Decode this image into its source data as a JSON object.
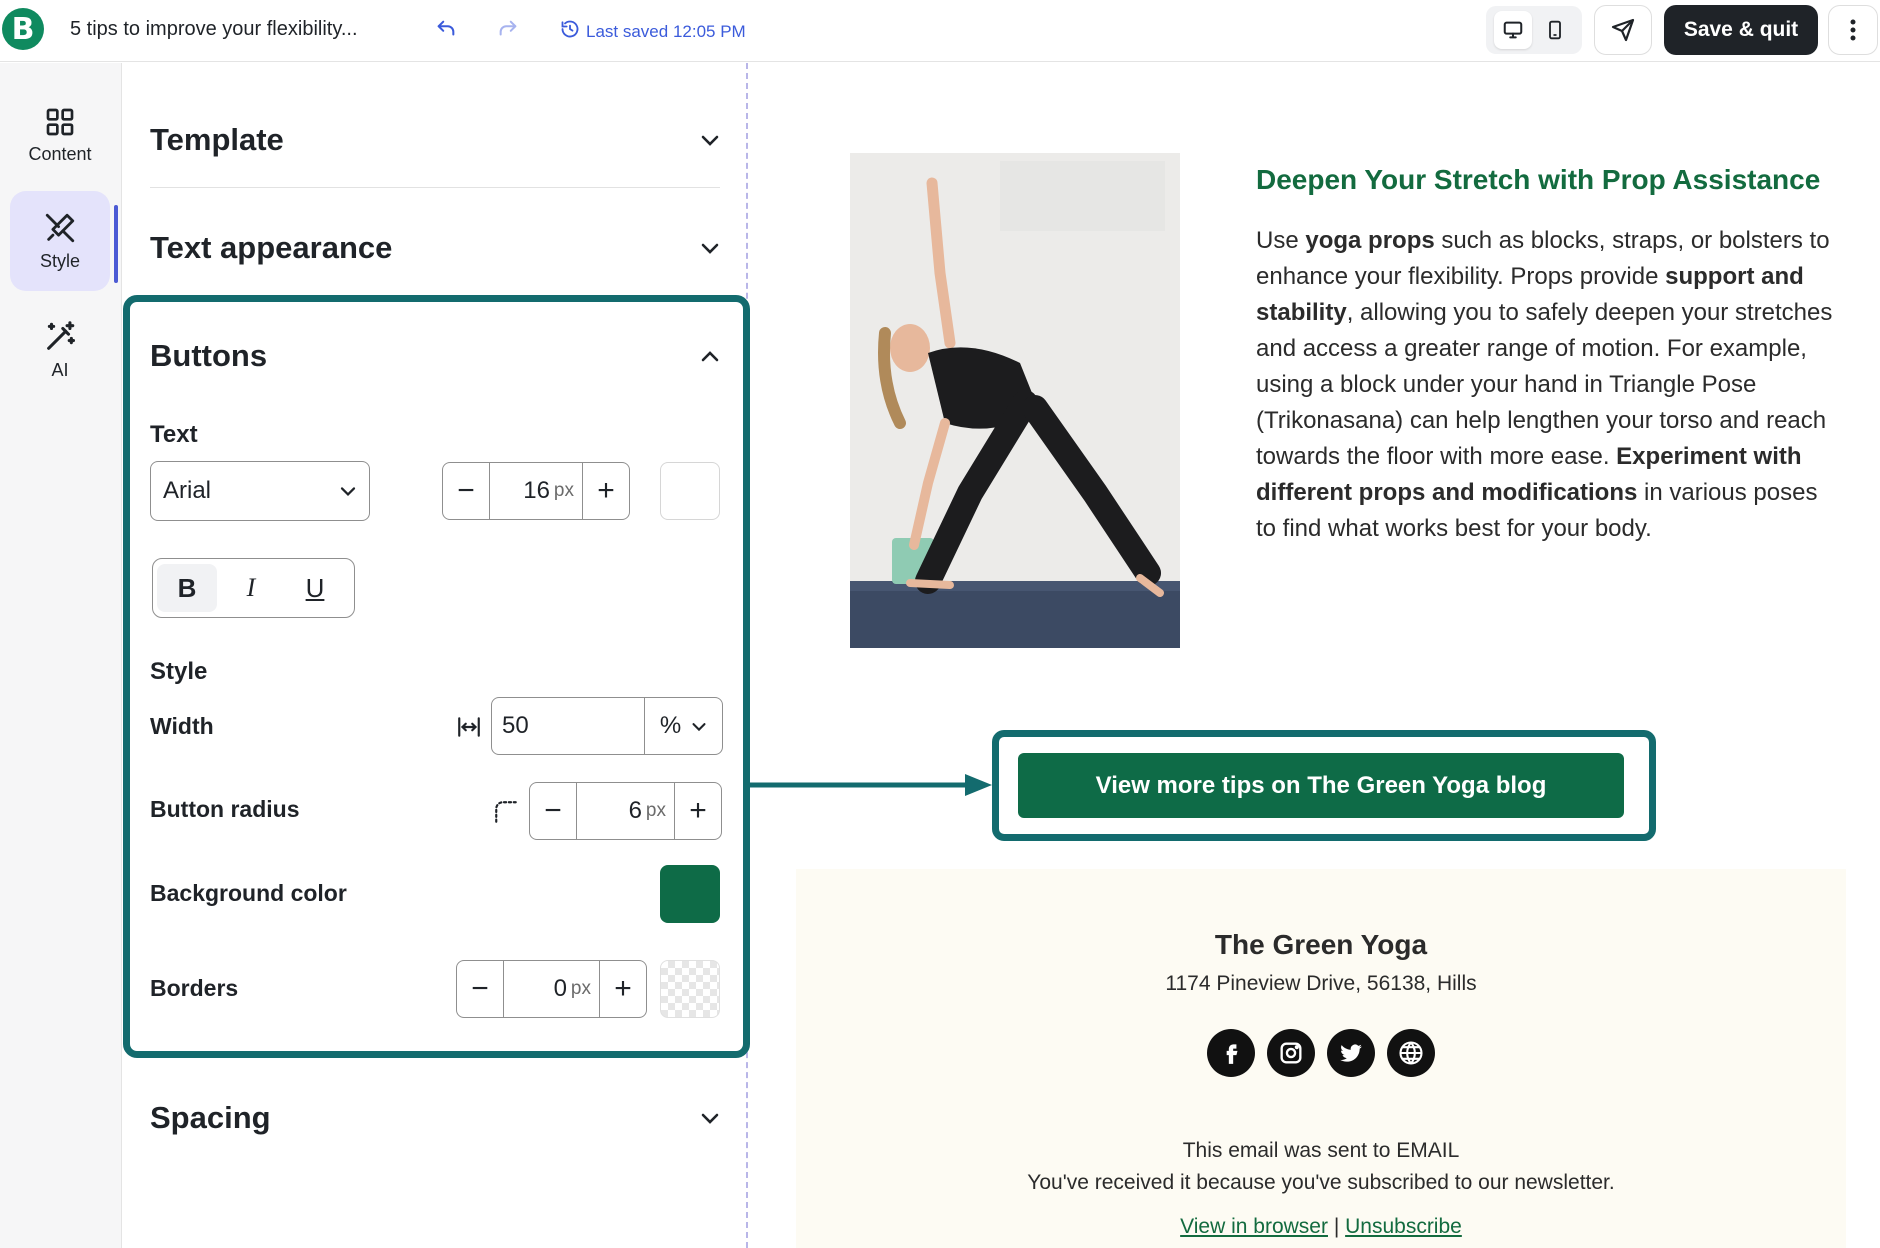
{
  "topbar": {
    "logo_letter": "B",
    "document_title": "5 tips to improve your flexibility...",
    "last_saved": "Last saved 12:05 PM",
    "save_quit_label": "Save & quit",
    "more_label": "⋮"
  },
  "rail": {
    "items": [
      {
        "label": "Content",
        "icon": "grid-icon"
      },
      {
        "label": "Style",
        "icon": "brush-icon",
        "active": true
      },
      {
        "label": "AI",
        "icon": "magic-wand-icon"
      }
    ]
  },
  "panel": {
    "template_label": "Template",
    "text_appearance_label": "Text appearance",
    "buttons_label": "Buttons",
    "spacing_label": "Spacing",
    "text_section": {
      "label": "Text",
      "font": "Arial",
      "font_size": "16",
      "font_size_unit": "px",
      "bold": "B",
      "italic": "I",
      "underline": "U"
    },
    "style_section": {
      "label": "Style",
      "width_label": "Width",
      "width_value": "50",
      "width_unit": "%",
      "radius_label": "Button radius",
      "radius_value": "6",
      "radius_unit": "px",
      "background_label": "Background color",
      "background_color": "#0e6b47",
      "borders_label": "Borders",
      "borders_value": "0",
      "borders_unit": "px"
    }
  },
  "email": {
    "title": "Deepen Your Stretch with Prop Assistance",
    "body": {
      "p1": "Use ",
      "b1": "yoga props",
      "p2": " such as blocks, straps, or bolsters to enhance your flexibility. Props provide ",
      "b2": "support and stability",
      "p3": ", allowing you to safely deepen your stretches and access a greater range of motion. For example, using a block under your hand in Triangle Pose (Trikonasana) can help lengthen your torso and reach towards the floor with more ease. ",
      "b3": "Experiment with different props and modifications",
      "p4": " in various poses to find what works best for your body."
    },
    "cta_label": "View more tips on The Green Yoga blog",
    "footer": {
      "brand": "The Green Yoga",
      "address": "1174 Pineview Drive, 56138, Hills",
      "sent_to_prefix": "This email was sent to ",
      "sent_to_value": "EMAIL",
      "reason": "You've received it because you've subscribed to our newsletter.",
      "view_in_browser": "View in browser",
      "separator": " | ",
      "unsubscribe": "Unsubscribe",
      "socials": [
        "facebook-icon",
        "instagram-icon",
        "twitter-icon",
        "globe-icon"
      ]
    }
  },
  "colors": {
    "brand_green": "#0e6b47",
    "highlight_teal": "#136b6e",
    "accent_blue": "#3b5bdb",
    "active_rail": "#e4e3fb"
  }
}
